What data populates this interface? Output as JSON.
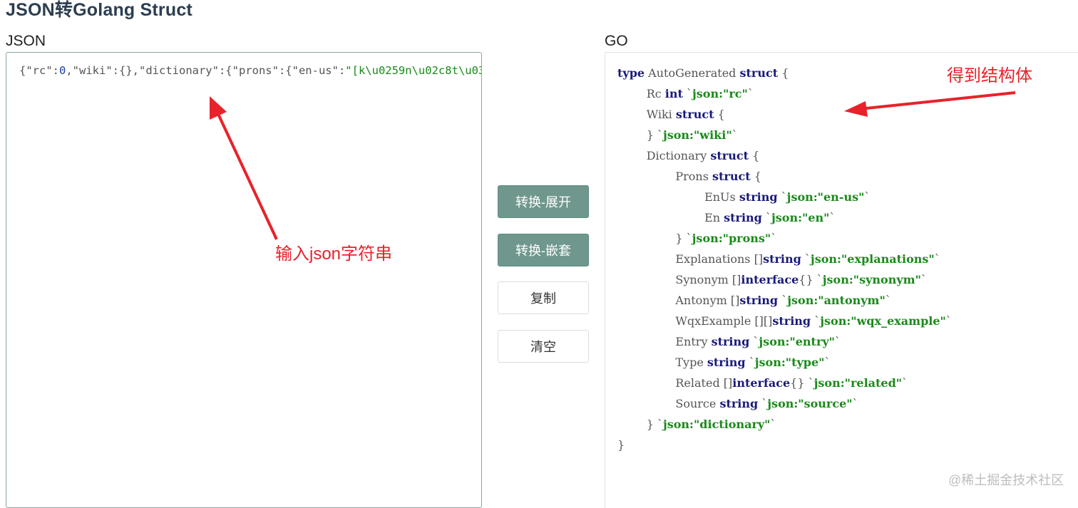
{
  "page": {
    "title": "JSON转Golang Struct"
  },
  "json_panel": {
    "label": "JSON",
    "content_parts": [
      {
        "text": "{\"rc\":",
        "kind": "plain"
      },
      {
        "text": "0",
        "kind": "num"
      },
      {
        "text": ",\"wiki\":{},\"dictionary\":{\"prons\":{\"en-us\":",
        "kind": "plain"
      },
      {
        "text": "\"[k\\u0259n\\u02c8t\\u03",
        "kind": "str"
      }
    ]
  },
  "go_panel": {
    "label": "GO",
    "lines": [
      {
        "indent": 0,
        "segments": [
          {
            "t": "type",
            "c": "kw"
          },
          {
            "t": " AutoGenerated ",
            "c": "plain"
          },
          {
            "t": "struct",
            "c": "kw"
          },
          {
            "t": " {",
            "c": "plain"
          }
        ]
      },
      {
        "indent": 1,
        "segments": [
          {
            "t": "Rc ",
            "c": "plain"
          },
          {
            "t": "int",
            "c": "kw"
          },
          {
            "t": " `",
            "c": "plain"
          },
          {
            "t": "json:\"rc\"",
            "c": "tag"
          },
          {
            "t": "`",
            "c": "plain"
          }
        ]
      },
      {
        "indent": 1,
        "segments": [
          {
            "t": "Wiki ",
            "c": "plain"
          },
          {
            "t": "struct",
            "c": "kw"
          },
          {
            "t": " {",
            "c": "plain"
          }
        ]
      },
      {
        "indent": 1,
        "segments": [
          {
            "t": "} `",
            "c": "plain"
          },
          {
            "t": "json:\"wiki\"",
            "c": "tag"
          },
          {
            "t": "`",
            "c": "plain"
          }
        ]
      },
      {
        "indent": 1,
        "segments": [
          {
            "t": "Dictionary ",
            "c": "plain"
          },
          {
            "t": "struct",
            "c": "kw"
          },
          {
            "t": " {",
            "c": "plain"
          }
        ]
      },
      {
        "indent": 2,
        "segments": [
          {
            "t": "Prons ",
            "c": "plain"
          },
          {
            "t": "struct",
            "c": "kw"
          },
          {
            "t": " {",
            "c": "plain"
          }
        ]
      },
      {
        "indent": 3,
        "segments": [
          {
            "t": "EnUs ",
            "c": "plain"
          },
          {
            "t": "string",
            "c": "kw"
          },
          {
            "t": " `",
            "c": "plain"
          },
          {
            "t": "json:\"en-us\"",
            "c": "tag"
          },
          {
            "t": "`",
            "c": "plain"
          }
        ]
      },
      {
        "indent": 3,
        "segments": [
          {
            "t": "En ",
            "c": "plain"
          },
          {
            "t": "string",
            "c": "kw"
          },
          {
            "t": " `",
            "c": "plain"
          },
          {
            "t": "json:\"en\"",
            "c": "tag"
          },
          {
            "t": "`",
            "c": "plain"
          }
        ]
      },
      {
        "indent": 2,
        "segments": [
          {
            "t": "} `",
            "c": "plain"
          },
          {
            "t": "json:\"prons\"",
            "c": "tag"
          },
          {
            "t": "`",
            "c": "plain"
          }
        ]
      },
      {
        "indent": 2,
        "segments": [
          {
            "t": "Explanations []",
            "c": "plain"
          },
          {
            "t": "string",
            "c": "kw"
          },
          {
            "t": " `",
            "c": "plain"
          },
          {
            "t": "json:\"explanations\"",
            "c": "tag"
          },
          {
            "t": "`",
            "c": "plain"
          }
        ]
      },
      {
        "indent": 2,
        "segments": [
          {
            "t": "Synonym []",
            "c": "plain"
          },
          {
            "t": "interface",
            "c": "kw"
          },
          {
            "t": "{} `",
            "c": "plain"
          },
          {
            "t": "json:\"synonym\"",
            "c": "tag"
          },
          {
            "t": "`",
            "c": "plain"
          }
        ]
      },
      {
        "indent": 2,
        "segments": [
          {
            "t": "Antonym []",
            "c": "plain"
          },
          {
            "t": "string",
            "c": "kw"
          },
          {
            "t": " `",
            "c": "plain"
          },
          {
            "t": "json:\"antonym\"",
            "c": "tag"
          },
          {
            "t": "`",
            "c": "plain"
          }
        ]
      },
      {
        "indent": 2,
        "segments": [
          {
            "t": "WqxExample [][]",
            "c": "plain"
          },
          {
            "t": "string",
            "c": "kw"
          },
          {
            "t": " `",
            "c": "plain"
          },
          {
            "t": "json:\"wqx_example\"",
            "c": "tag"
          },
          {
            "t": "`",
            "c": "plain"
          }
        ]
      },
      {
        "indent": 2,
        "segments": [
          {
            "t": "Entry ",
            "c": "plain"
          },
          {
            "t": "string",
            "c": "kw"
          },
          {
            "t": " `",
            "c": "plain"
          },
          {
            "t": "json:\"entry\"",
            "c": "tag"
          },
          {
            "t": "`",
            "c": "plain"
          }
        ]
      },
      {
        "indent": 2,
        "segments": [
          {
            "t": "Type ",
            "c": "plain"
          },
          {
            "t": "string",
            "c": "kw"
          },
          {
            "t": " `",
            "c": "plain"
          },
          {
            "t": "json:\"type\"",
            "c": "tag"
          },
          {
            "t": "`",
            "c": "plain"
          }
        ]
      },
      {
        "indent": 2,
        "segments": [
          {
            "t": "Related []",
            "c": "plain"
          },
          {
            "t": "interface",
            "c": "kw"
          },
          {
            "t": "{} `",
            "c": "plain"
          },
          {
            "t": "json:\"related\"",
            "c": "tag"
          },
          {
            "t": "`",
            "c": "plain"
          }
        ]
      },
      {
        "indent": 2,
        "segments": [
          {
            "t": "Source ",
            "c": "plain"
          },
          {
            "t": "string",
            "c": "kw"
          },
          {
            "t": " `",
            "c": "plain"
          },
          {
            "t": "json:\"source\"",
            "c": "tag"
          },
          {
            "t": "`",
            "c": "plain"
          }
        ]
      },
      {
        "indent": 1,
        "segments": [
          {
            "t": "} `",
            "c": "plain"
          },
          {
            "t": "json:\"dictionary\"",
            "c": "tag"
          },
          {
            "t": "`",
            "c": "plain"
          }
        ]
      },
      {
        "indent": 0,
        "segments": [
          {
            "t": "}",
            "c": "plain"
          }
        ]
      }
    ]
  },
  "buttons": {
    "convert_expand": "转换-展开",
    "convert_nested": "转换-嵌套",
    "copy": "复制",
    "clear": "清空"
  },
  "annotations": {
    "input_note": "输入json字符串",
    "result_note": "得到结构体",
    "color": "#e8222a"
  },
  "watermark": "@稀土掘金技术社区",
  "colors": {
    "primary_button": "#6f978d",
    "keyword": "#1a1a7a",
    "tag": "#1a8a1a",
    "title": "#2c3e50"
  }
}
